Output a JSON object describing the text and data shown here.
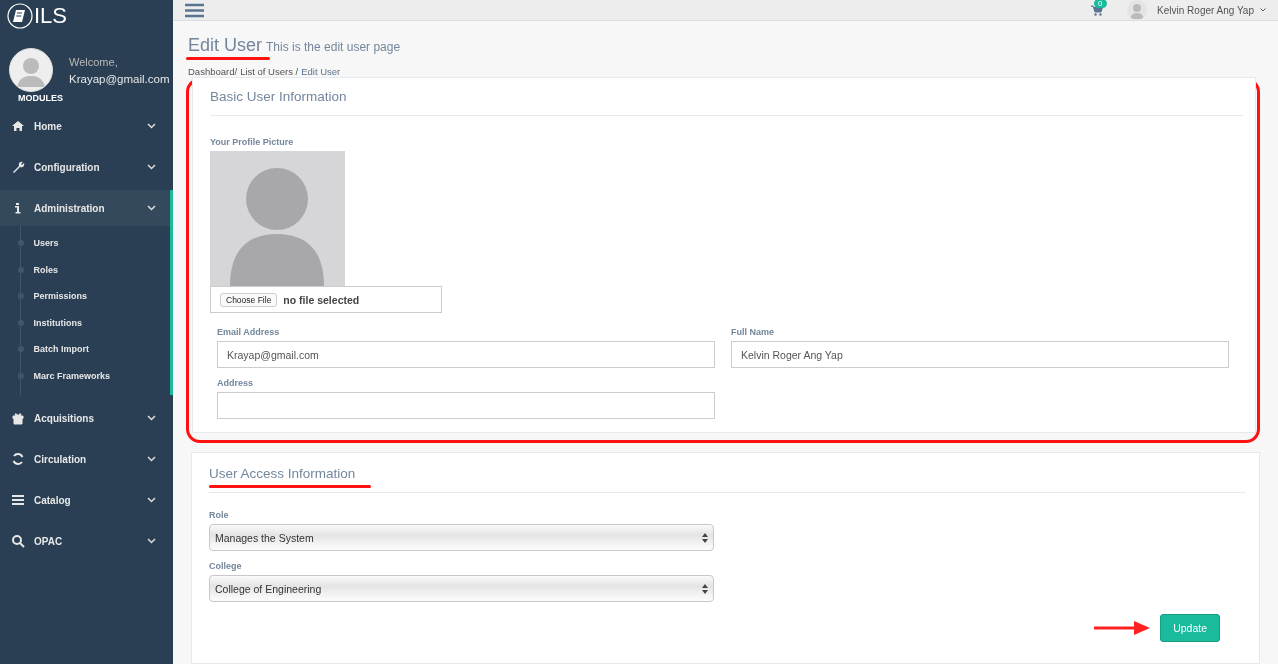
{
  "app": {
    "logo": "ILS"
  },
  "sidebar": {
    "welcome": "Welcome,",
    "user": "Krayap@gmail.com",
    "section": "MODULES",
    "items": [
      {
        "label": "Home",
        "kind": "home",
        "selected": false
      },
      {
        "label": "Configuration",
        "kind": "wrench",
        "selected": false
      },
      {
        "label": "Administration",
        "kind": "info",
        "selected": true,
        "expanded": true,
        "children": [
          {
            "label": "Users"
          },
          {
            "label": "Roles"
          },
          {
            "label": "Permissions"
          },
          {
            "label": "Institutions"
          },
          {
            "label": "Batch Import"
          },
          {
            "label": "Marc Frameworks"
          }
        ]
      },
      {
        "label": "Acquisitions",
        "kind": "gift",
        "selected": false
      },
      {
        "label": "Circulation",
        "kind": "refresh",
        "selected": false
      },
      {
        "label": "Catalog",
        "kind": "bars",
        "selected": false
      },
      {
        "label": "OPAC",
        "kind": "search",
        "selected": false
      }
    ]
  },
  "topbar": {
    "cart_count": "0",
    "user_name": "Kelvin Roger Ang Yap"
  },
  "page": {
    "title": "Edit User",
    "subtitle": "This is the edit user page",
    "breadcrumb": [
      {
        "label": "Dashboard/",
        "current": false
      },
      {
        "label": "List of Users /",
        "current": false
      },
      {
        "label": "Edit User",
        "current": true
      }
    ]
  },
  "basic": {
    "title": "Basic User Information",
    "picture_label": "Your Profile Picture",
    "file_button": "Choose File",
    "file_status": "no file selected",
    "fields": [
      {
        "label": "Email Address",
        "value": "Krayap@gmail.com"
      },
      {
        "label": "Full Name",
        "value": "Kelvin Roger Ang Yap"
      },
      {
        "label": "Address"
      }
    ]
  },
  "access": {
    "title": "User Access Information",
    "selects": [
      {
        "label": "Role",
        "value": "Manages the System"
      },
      {
        "label": "College",
        "value": "College of Engineering"
      }
    ],
    "button": "Update"
  }
}
